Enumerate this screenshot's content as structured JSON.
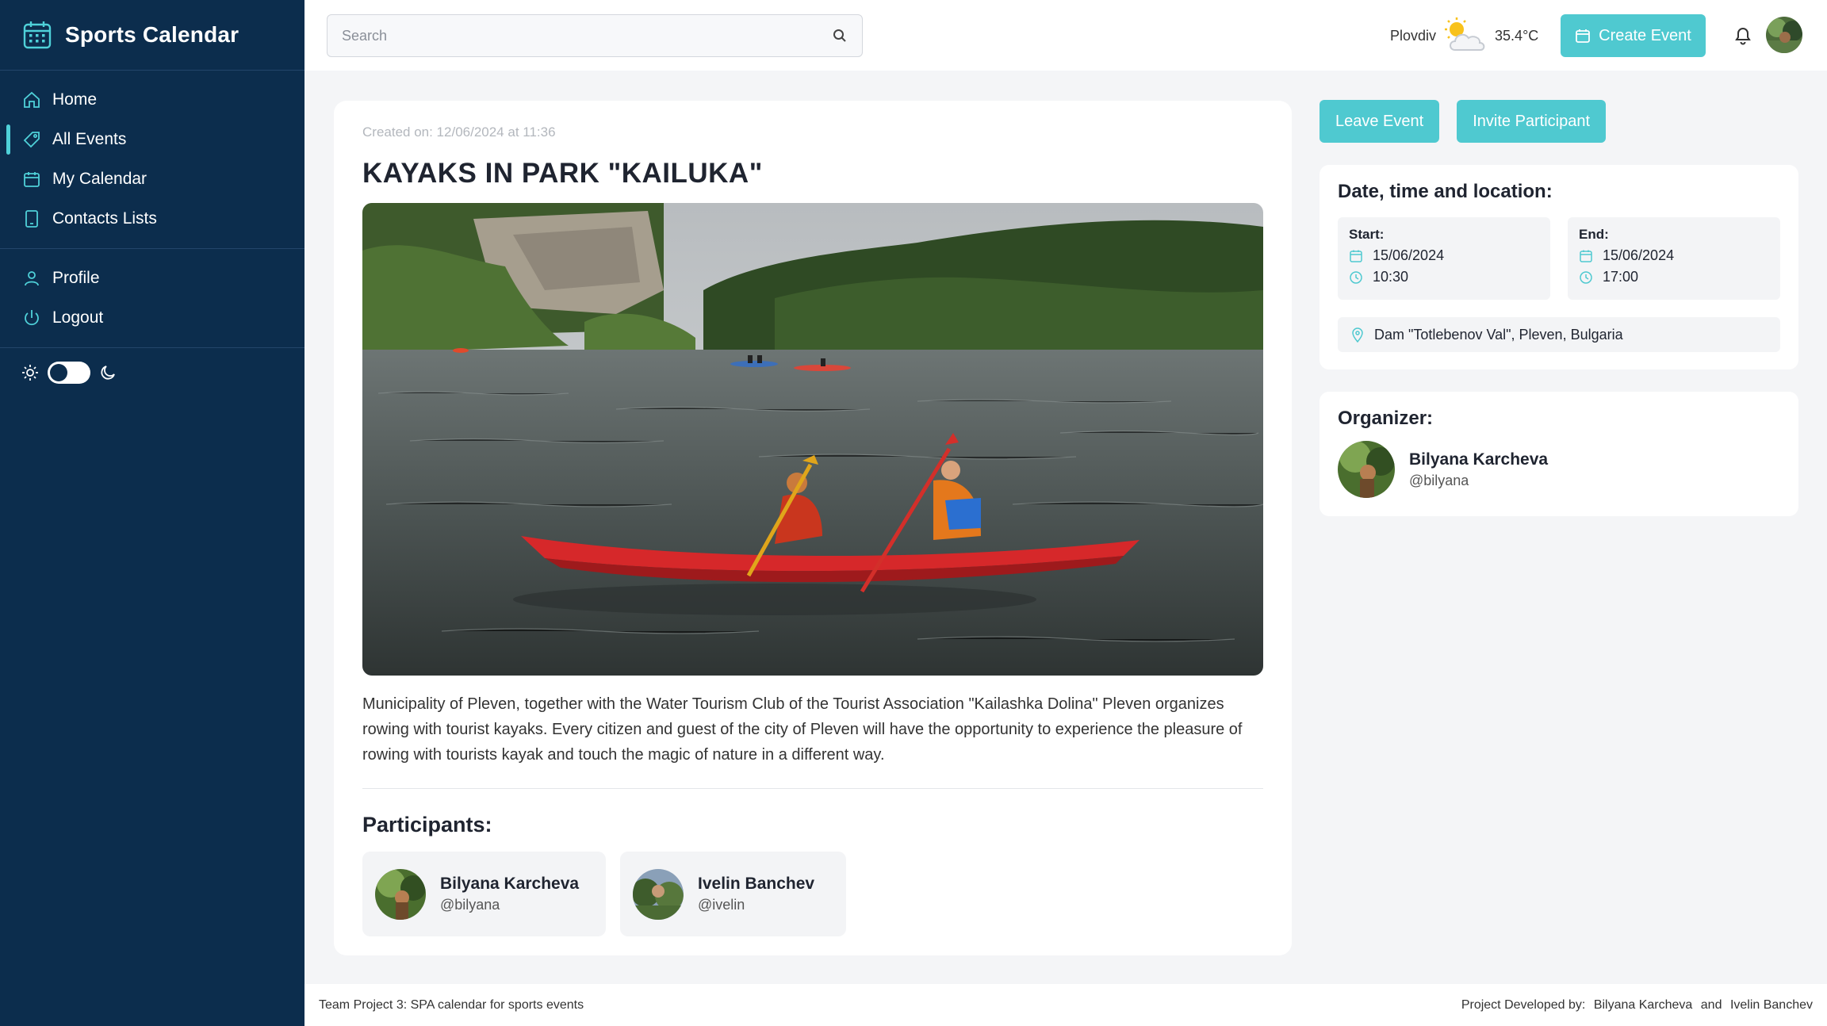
{
  "app": {
    "title": "Sports Calendar",
    "logo_icon": "calendar-icon"
  },
  "sidebar": {
    "nav": [
      {
        "label": "Home",
        "icon": "home-icon"
      },
      {
        "label": "All Events",
        "icon": "tag-icon",
        "active": true
      },
      {
        "label": "My Calendar",
        "icon": "calendar-icon"
      },
      {
        "label": "Contacts Lists",
        "icon": "phone-book-icon"
      }
    ],
    "account": [
      {
        "label": "Profile",
        "icon": "user-icon"
      },
      {
        "label": "Logout",
        "icon": "power-icon"
      }
    ],
    "theme_toggle": {
      "state": "light"
    }
  },
  "topbar": {
    "search_placeholder": "Search",
    "weather": {
      "city": "Plovdiv",
      "temperature": "35.4°C",
      "icon": "partly-sunny-icon"
    },
    "create_label": "Create Event"
  },
  "event": {
    "created": "Created on: 12/06/2024 at 11:36",
    "title": "KAYAKS IN PARK \"KAILUKA\"",
    "description": "Municipality of Pleven, together with the Water Tourism Club of the Tourist Association \"Kailashka Dolina\" Pleven organizes rowing with tourist kayaks. Every citizen and guest of the city of Pleven will have the opportunity to experience the pleasure of rowing with tourists kayak and touch the magic of nature in a different way.",
    "participants_heading": "Participants:",
    "participants": [
      {
        "name": "Bilyana Karcheva",
        "username": "@bilyana"
      },
      {
        "name": "Ivelin Banchev",
        "username": "@ivelin"
      }
    ]
  },
  "actions": {
    "leave": "Leave Event",
    "invite": "Invite Participant"
  },
  "details": {
    "heading": "Date, time and location:",
    "start": {
      "label": "Start:",
      "date": "15/06/2024",
      "time": "10:30"
    },
    "end": {
      "label": "End:",
      "date": "15/06/2024",
      "time": "17:00"
    },
    "location": "Dam \"Totlebenov Val\", Pleven, Bulgaria"
  },
  "organizer": {
    "heading": "Organizer:",
    "name": "Bilyana Karcheva",
    "username": "@bilyana"
  },
  "footer": {
    "left": "Team Project 3: SPA calendar for sports events",
    "right_prefix": "Project Developed by:",
    "dev1": "Bilyana Karcheva",
    "and": "and",
    "dev2": "Ivelin Banchev"
  },
  "colors": {
    "sidebar": "#0c2d4d",
    "accent": "#4fc9d0",
    "active_marker": "#4fd1d9"
  }
}
